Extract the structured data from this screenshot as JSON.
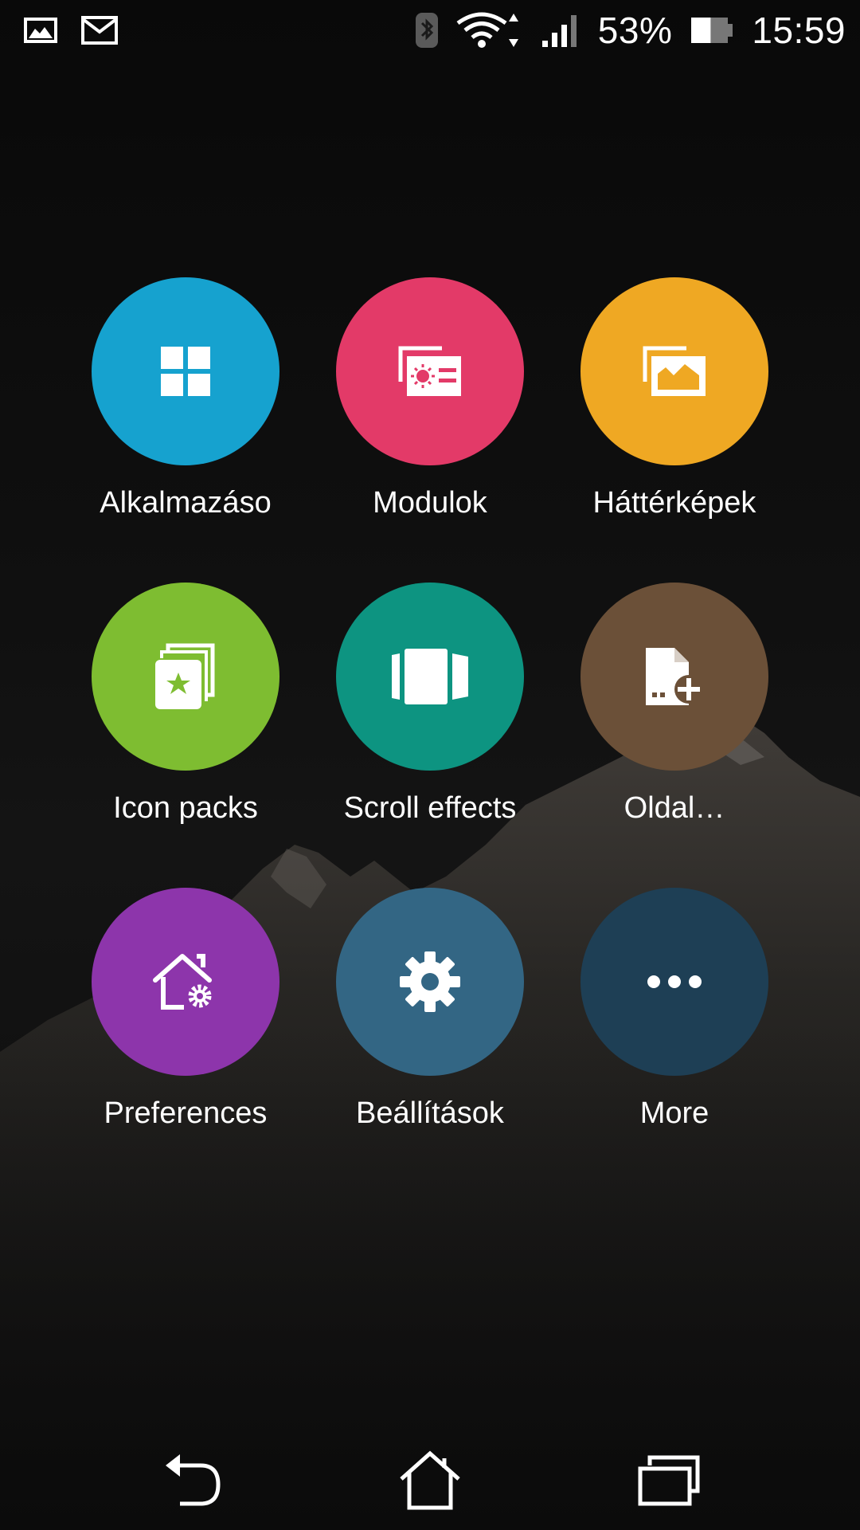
{
  "status_bar": {
    "battery_percent": "53%",
    "time": "15:59",
    "battery_level": 0.53,
    "icons": [
      "image-notification-icon",
      "gmail-notification-icon",
      "bluetooth-icon",
      "wifi-icon",
      "signal-icon",
      "battery-icon"
    ]
  },
  "menu": {
    "items": [
      {
        "label": "Alkalmazáso",
        "color": "#16a2cf",
        "icon": "apps-grid-icon"
      },
      {
        "label": "Modulok",
        "color": "#e33a68",
        "icon": "widgets-icon"
      },
      {
        "label": "Háttérképek",
        "color": "#efa823",
        "icon": "wallpapers-icon"
      },
      {
        "label": "Icon packs",
        "color": "#7ebd31",
        "icon": "icon-packs-icon"
      },
      {
        "label": "Scroll effects",
        "color": "#0d9481",
        "icon": "scroll-effects-icon"
      },
      {
        "label": "Oldal…",
        "color": "#6b5038",
        "icon": "add-page-icon"
      },
      {
        "label": "Preferences",
        "color": "#8d35ab",
        "icon": "home-settings-icon"
      },
      {
        "label": "Beállítások",
        "color": "#336684",
        "icon": "settings-gear-icon"
      },
      {
        "label": "More",
        "color": "#1e3f55",
        "icon": "more-dots-icon"
      }
    ]
  },
  "nav_bar": {
    "icons": [
      "back-icon",
      "home-icon",
      "recents-icon"
    ]
  }
}
